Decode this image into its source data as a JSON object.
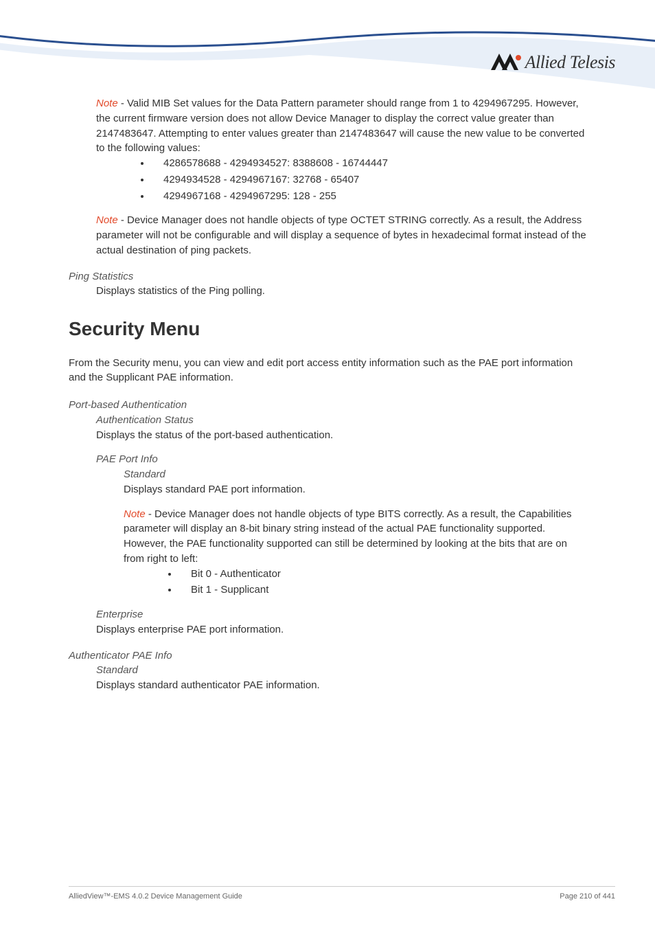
{
  "logo_text": "Allied Telesis",
  "note1": {
    "label": "Note",
    "body": " - Valid MIB Set values for the Data Pattern parameter should range from 1 to 4294967295. However, the current firmware version does not allow Device Manager to display the correct value greater than 2147483647. Attempting to enter values greater than 2147483647 will cause the new value to be converted to the following values:",
    "bullets": [
      "4286578688 - 4294934527: 8388608 - 16744447",
      "4294934528 - 4294967167: 32768 - 65407",
      "4294967168 - 4294967295: 128 - 255"
    ]
  },
  "note2": {
    "label": "Note",
    "body": " - Device Manager does not handle objects of type OCTET STRING correctly. As a result, the Address parameter will not be configurable and will display a sequence of bytes in hexadecimal format instead of the actual destination of ping packets."
  },
  "ping_stats": {
    "title": "Ping Statistics",
    "body": "Displays statistics of the Ping polling."
  },
  "security": {
    "heading": "Security Menu",
    "intro": "From the Security menu, you can view and edit port access entity information such as the PAE port information and the Supplicant PAE information."
  },
  "pba": {
    "title": "Port-based Authentication",
    "auth_status": {
      "title": "Authentication Status",
      "body": "Displays the status of the port-based authentication."
    },
    "pae_port_info": {
      "title": "PAE Port Info",
      "standard": {
        "title": "Standard",
        "body": "Displays standard PAE port information."
      },
      "note": {
        "label": "Note",
        "body": " - Device Manager does not handle objects of type BITS correctly. As a result, the Capabilities parameter will display an 8-bit binary string instead of the actual PAE functionality supported. However, the PAE functionality supported can still be determined by looking at the bits that are on from right to left:",
        "bullets": [
          "Bit 0 - Authenticator",
          "Bit 1 - Supplicant"
        ]
      },
      "enterprise": {
        "title": "Enterprise",
        "body": "Displays enterprise PAE port information."
      }
    }
  },
  "auth_pae": {
    "title": "Authenticator PAE Info",
    "standard": {
      "title": "Standard",
      "body": "Displays standard authenticator PAE information."
    }
  },
  "footer": {
    "left": "AlliedView™-EMS 4.0.2 Device Management Guide",
    "right": "Page 210 of 441"
  }
}
